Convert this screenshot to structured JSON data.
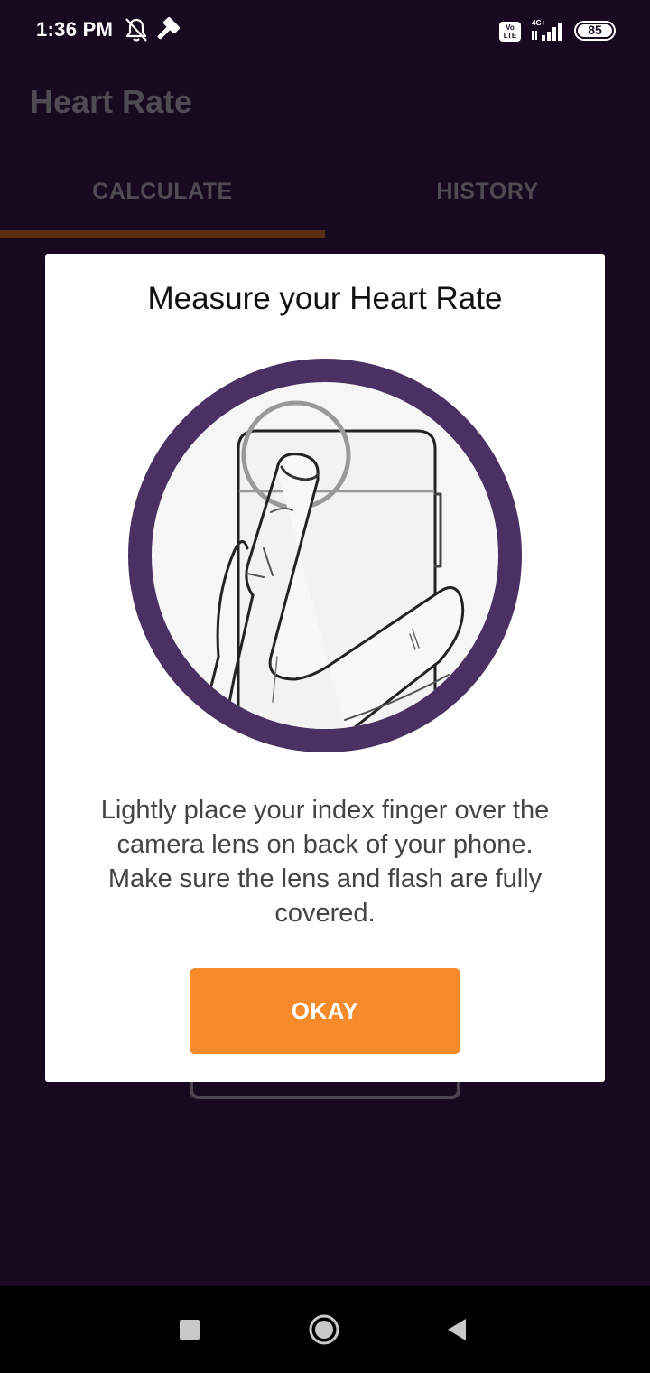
{
  "status_bar": {
    "time": "1:36 PM",
    "network_label": "4G+",
    "volte_label": "Vo LTE",
    "battery_level": "85",
    "icons": [
      "bell-off-icon",
      "hammer-icon",
      "volte-icon",
      "signal-icon",
      "battery-icon"
    ]
  },
  "app": {
    "title": "Heart Rate"
  },
  "tabs": [
    {
      "label": "CALCULATE",
      "selected": true
    },
    {
      "label": "HISTORY",
      "selected": false
    }
  ],
  "dialog": {
    "title": "Measure your Heart Rate",
    "illustration": "finger-on-camera-illustration",
    "body": "Lightly place your index finger over the camera lens on back of your phone. Make sure the lens and flash are fully covered.",
    "button_label": "OKAY"
  },
  "nav_bar": {
    "icons": [
      "recents-icon",
      "home-icon",
      "back-icon"
    ]
  },
  "colors": {
    "background": "#17091f",
    "accent": "#f58a2a",
    "ring": "#4b3063",
    "tab_indicator": "#5b3013"
  }
}
